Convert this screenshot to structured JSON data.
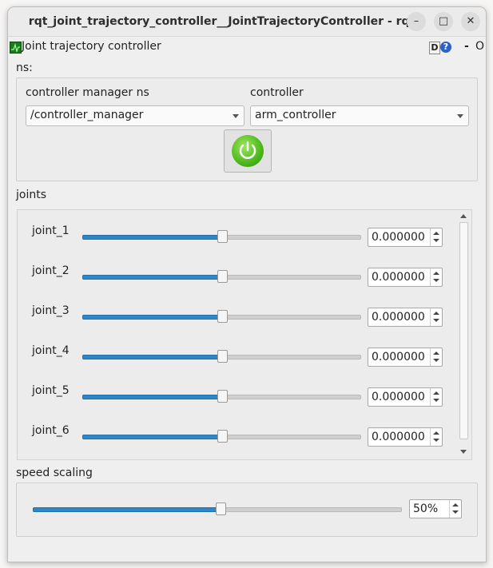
{
  "window": {
    "title": "rqt_joint_trajectory_controller__JointTrajectoryController - rqt",
    "minimize_glyph": "–",
    "maximize_glyph": "□",
    "close_glyph": "✕"
  },
  "plugin": {
    "title": "Joint trajectory controller",
    "d_label": "D",
    "help_label": "?",
    "dash_label": "-",
    "o_label": "O"
  },
  "ns_label": "ns:",
  "controller_manager": {
    "label": "controller manager ns",
    "value": "/controller_manager"
  },
  "controller": {
    "label": "controller",
    "value": "arm_controller"
  },
  "enable_button": {
    "icon": "power-icon",
    "state": "on",
    "color": "#4cb81c"
  },
  "joints_label": "joints",
  "joints": [
    {
      "name": "joint_1",
      "value": "0.000000",
      "slider_fraction": 0.5
    },
    {
      "name": "joint_2",
      "value": "0.000000",
      "slider_fraction": 0.5
    },
    {
      "name": "joint_3",
      "value": "0.000000",
      "slider_fraction": 0.5
    },
    {
      "name": "joint_4",
      "value": "0.000000",
      "slider_fraction": 0.5
    },
    {
      "name": "joint_5",
      "value": "0.000000",
      "slider_fraction": 0.5
    },
    {
      "name": "joint_6",
      "value": "0.000000",
      "slider_fraction": 0.5
    }
  ],
  "speed_scaling": {
    "label": "speed scaling",
    "value": "50%",
    "slider_fraction": 0.5
  },
  "colors": {
    "slider_fill": "#2f87c8",
    "power_green": "#4cb81c"
  }
}
